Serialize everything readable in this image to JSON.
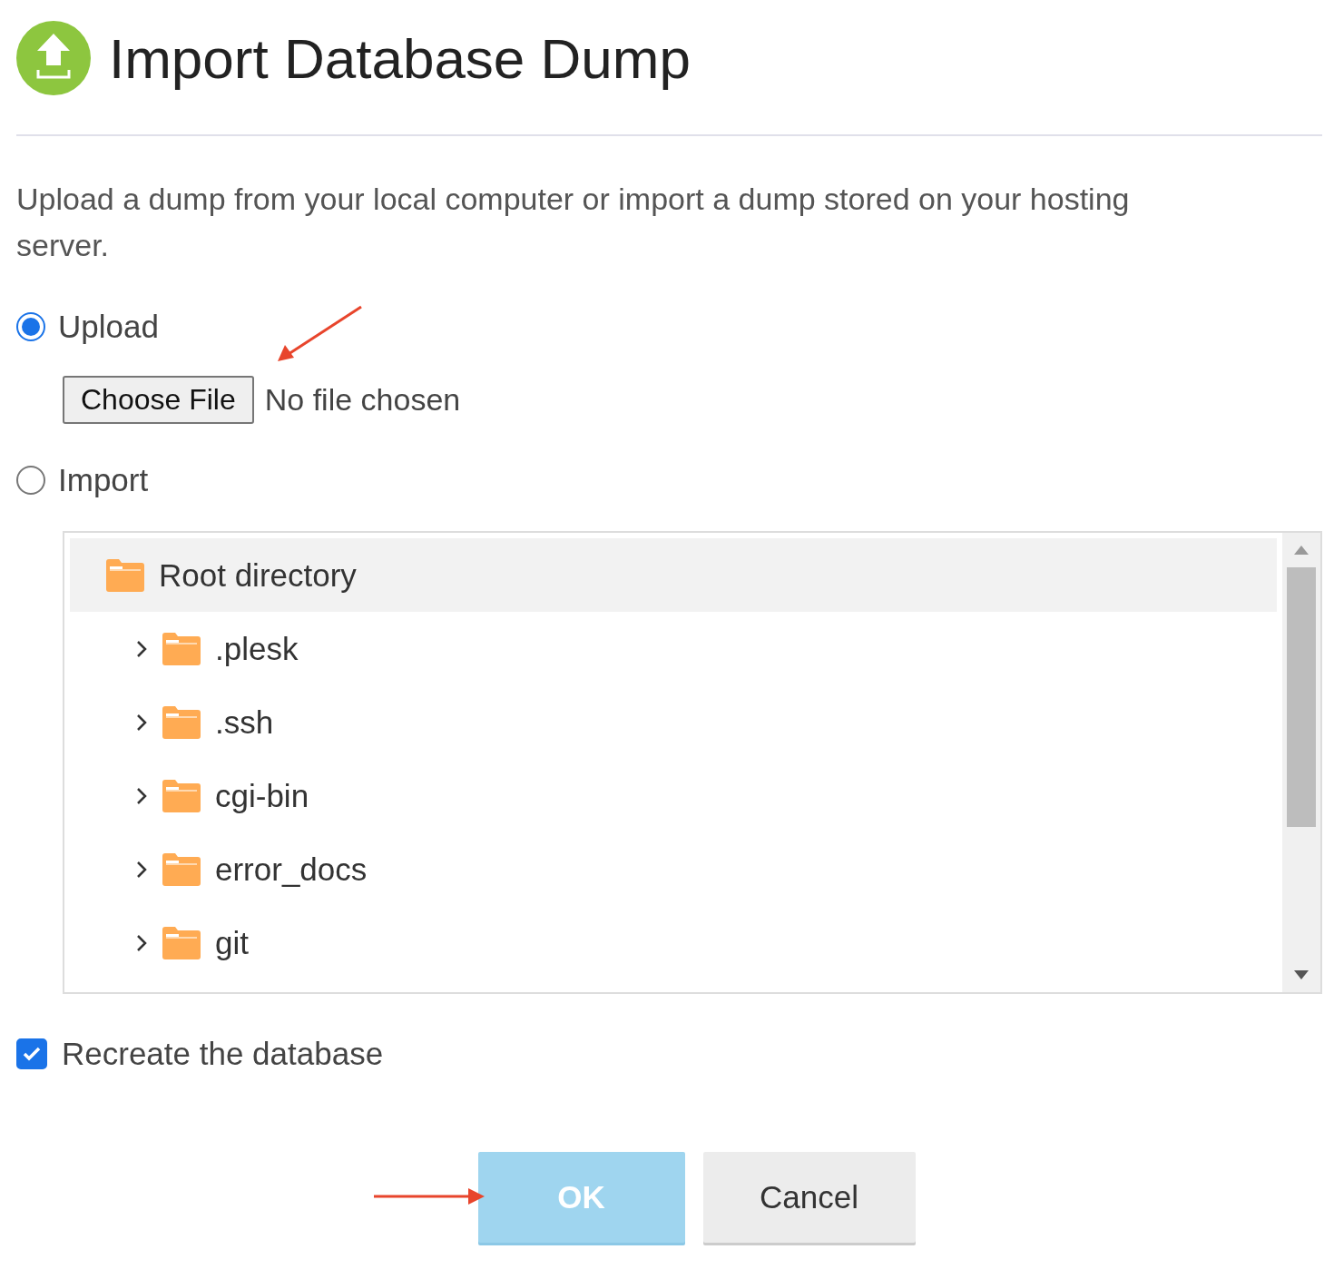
{
  "title": "Import Database Dump",
  "description": "Upload a dump from your local computer or import a dump stored on your hosting server.",
  "source_options": [
    {
      "label": "Upload",
      "selected": true,
      "kind": "file",
      "file_button": "Choose File",
      "file_status": "No file chosen"
    },
    {
      "label": "Import",
      "selected": false,
      "kind": "tree"
    }
  ],
  "tree": {
    "label": "Root directory",
    "selected": true,
    "children": [
      {
        "label": ".plesk",
        "selected": false,
        "expanded": false
      },
      {
        "label": ".ssh",
        "selected": false,
        "expanded": false
      },
      {
        "label": "cgi-bin",
        "selected": false,
        "expanded": false
      },
      {
        "label": "error_docs",
        "selected": false,
        "expanded": false
      },
      {
        "label": "git",
        "selected": false,
        "expanded": false
      }
    ]
  },
  "recreate": {
    "label": "Recreate the database",
    "checked": true
  },
  "buttons": [
    {
      "label": "OK",
      "kind": "primary",
      "disabled": true
    },
    {
      "label": "Cancel",
      "kind": "secondary",
      "disabled": false
    }
  ]
}
